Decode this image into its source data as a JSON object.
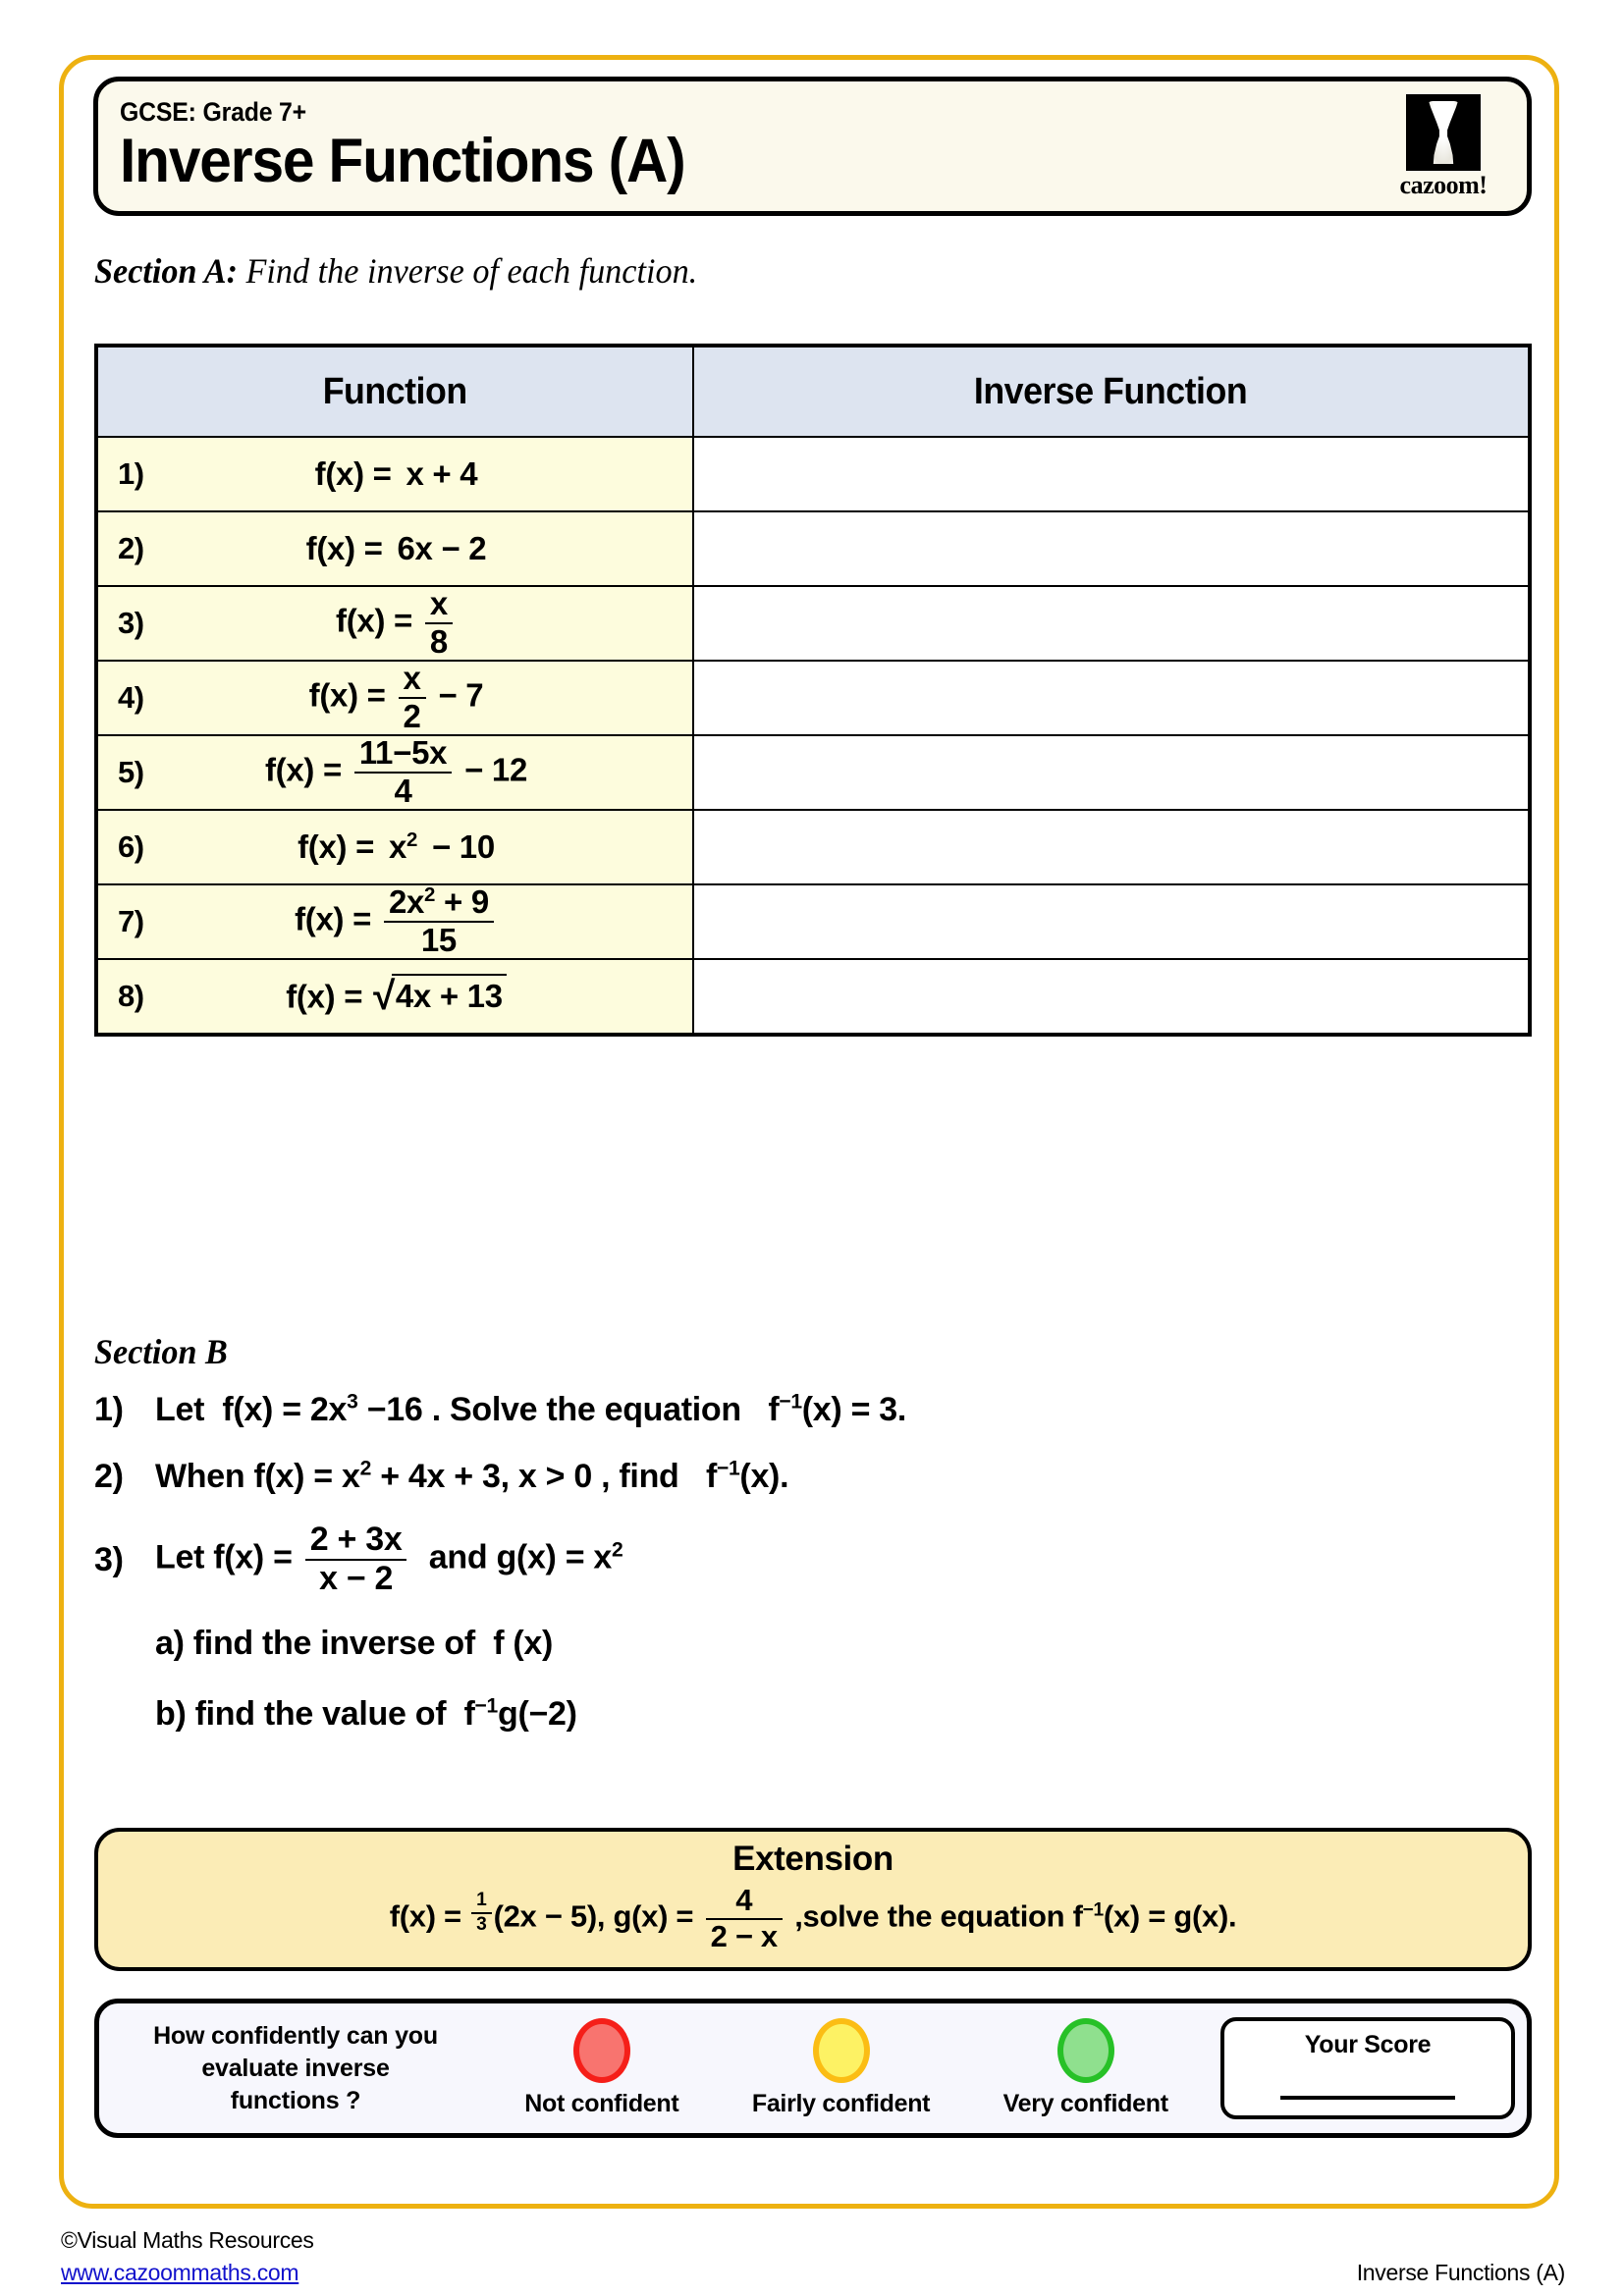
{
  "header": {
    "grade": "GCSE: Grade 7+",
    "title": "Inverse Functions (A)",
    "logo_word": "cazoom!"
  },
  "section_a": {
    "label": "Section A:",
    "instruction": "Find the inverse of each function.",
    "columns": {
      "function": "Function",
      "inverse": "Inverse Function"
    },
    "rows": [
      {
        "num": "1)",
        "fn_plain": "f(x) = x + 4"
      },
      {
        "num": "2)",
        "fn_plain": "f(x) = 6x − 2"
      },
      {
        "num": "3)",
        "fn_plain": "f(x) = x/8"
      },
      {
        "num": "4)",
        "fn_plain": "f(x) = x/2 − 7"
      },
      {
        "num": "5)",
        "fn_plain": "f(x) = (11 − 5x)/4 − 12"
      },
      {
        "num": "6)",
        "fn_plain": "f(x) = x² − 10"
      },
      {
        "num": "7)",
        "fn_plain": "f(x) = (2x² + 9)/15"
      },
      {
        "num": "8)",
        "fn_plain": "f(x) = √(4x + 13)"
      }
    ],
    "parts": {
      "fx_eq": "f(x) =",
      "x": "x",
      "eight": "8",
      "two": "2",
      "four": "4",
      "fifteen": "15",
      "plus4": "x + 4",
      "sixx_minus2": "6x − 2",
      "minus7": "− 7",
      "num_11_5x": "11−5x",
      "minus12": "− 12",
      "x2_minus10_base": "x",
      "x2_minus10_rest": "− 10",
      "num_2x2_9_base": "2x",
      "num_2x2_9_rest": "+ 9",
      "sqrt_sign": "√",
      "sqrt_radicand": "4x + 13",
      "exp2": "2"
    }
  },
  "section_b": {
    "heading": "Section B",
    "questions": [
      {
        "num": "1)",
        "plain": "Let f(x) = 2x³ − 16 . Solve the equation f⁻¹(x) = 3 .",
        "t1": "Let",
        "t2": "f(x) = 2x",
        "exp1": "3",
        "t3": "−16",
        "t4": ". Solve the equation",
        "t5": "f",
        "exp2": "−1",
        "t6": "(x) = 3",
        "t7": "."
      },
      {
        "num": "2)",
        "plain": "When f(x) = x² + 4x + 3, x > 0 , find f⁻¹(x).",
        "t1": "When f(x) = x",
        "exp1": "2",
        "t2": "+ 4x + 3, x > 0 , find",
        "t3": "f",
        "exp2": "−1",
        "t4": "(x)."
      },
      {
        "num": "3)",
        "plain": "Let f(x) = (2 + 3x)/(x − 2) and g(x) = x²",
        "t1": "Let f(x) =",
        "frac_num": "2 + 3x",
        "frac_den": "x − 2",
        "t2": "and g(x) = x",
        "exp1": "2"
      }
    ],
    "sub_parts": [
      {
        "plain": "a) find the inverse of  f (x)",
        "t1": "a) find the inverse of",
        "t2": "f (x)"
      },
      {
        "plain": "b) find the value of  f⁻¹g(−2)",
        "t1": "b) find the value of",
        "t2": "f",
        "exp": "−1",
        "t3": "g(−2)"
      }
    ]
  },
  "extension": {
    "title": "Extension",
    "plain": "f(x) = ⅓(2x − 5), g(x) = 4/(2 − x) , solve the equation f⁻¹(x) = g(x).",
    "t1": "f(x) =",
    "frac1_num": "1",
    "frac1_den": "3",
    "t2": "(2x − 5), g(x) =",
    "frac2_num": "4",
    "frac2_den": "2 − x",
    "t3": ",solve the equation f",
    "exp": "−1",
    "t4": "(x) = g(x)."
  },
  "confidence": {
    "question": "How confidently can you evaluate inverse functions ?",
    "question_line1": "How confidently can you",
    "question_line2": "evaluate inverse",
    "question_line3": "functions ?",
    "lights": [
      {
        "label": "Not confident",
        "color": "#f8746f",
        "border": "#f51f19"
      },
      {
        "label": "Fairly confident",
        "color": "#fdf264",
        "border": "#fbbd14"
      },
      {
        "label": "Very confident",
        "color": "#8fe08e",
        "border": "#27c127"
      }
    ],
    "score_title": "Your Score"
  },
  "footer": {
    "copyright": "©Visual Maths Resources",
    "url": "www.cazoommaths.com",
    "worksheet_name": "Inverse Functions (A)"
  },
  "colors": {
    "page_border": "#edb111",
    "table_header_bg": "#dde4f0",
    "function_cell_bg": "#fdfcdd",
    "extension_bg": "#fbecb6",
    "confidence_bg": "#f7f7fd",
    "title_bg": "#fbf9ec",
    "link": "#1111cc"
  }
}
